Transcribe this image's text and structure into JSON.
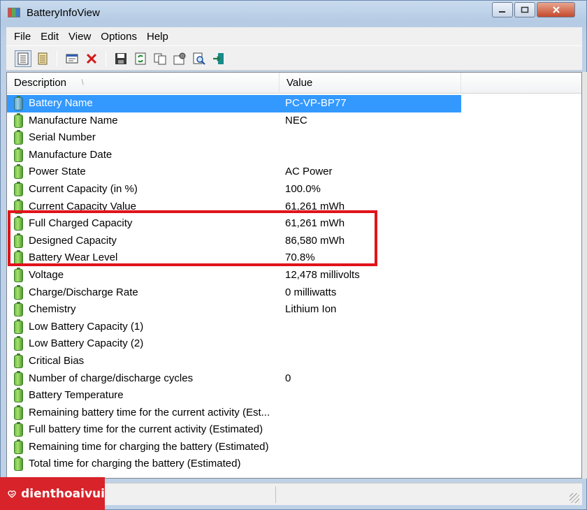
{
  "window": {
    "title": "BatteryInfoView"
  },
  "menu": [
    "File",
    "Edit",
    "View",
    "Options",
    "Help"
  ],
  "toolbar": {
    "buttons": [
      "view-list-icon",
      "view-html-icon",
      "properties-icon",
      "delete-icon",
      "save-icon",
      "refresh-icon",
      "copy-icon",
      "advanced-options-icon",
      "find-icon",
      "exit-icon"
    ]
  },
  "columns": {
    "description": "Description",
    "value": "Value"
  },
  "rows": [
    {
      "label": "Battery Name",
      "value": "PC-VP-BP77"
    },
    {
      "label": "Manufacture Name",
      "value": "NEC"
    },
    {
      "label": "Serial Number",
      "value": ""
    },
    {
      "label": "Manufacture Date",
      "value": ""
    },
    {
      "label": "Power State",
      "value": "AC Power"
    },
    {
      "label": "Current Capacity (in %)",
      "value": "100.0%"
    },
    {
      "label": "Current Capacity Value",
      "value": "61,261 mWh"
    },
    {
      "label": "Full Charged Capacity",
      "value": "61,261 mWh"
    },
    {
      "label": "Designed Capacity",
      "value": "86,580 mWh"
    },
    {
      "label": "Battery Wear Level",
      "value": "70.8%"
    },
    {
      "label": "Voltage",
      "value": "12,478 millivolts"
    },
    {
      "label": "Charge/Discharge Rate",
      "value": "0 milliwatts"
    },
    {
      "label": "Chemistry",
      "value": "Lithium Ion"
    },
    {
      "label": "Low Battery Capacity (1)",
      "value": ""
    },
    {
      "label": "Low Battery Capacity (2)",
      "value": ""
    },
    {
      "label": "Critical Bias",
      "value": ""
    },
    {
      "label": "Number of charge/discharge cycles",
      "value": "0"
    },
    {
      "label": "Battery Temperature",
      "value": ""
    },
    {
      "label": "Remaining battery time for the current activity (Est...",
      "value": ""
    },
    {
      "label": "Full battery time for the current activity (Estimated)",
      "value": ""
    },
    {
      "label": "Remaining time for charging the battery (Estimated)",
      "value": ""
    },
    {
      "label": "Total  time for charging the battery (Estimated)",
      "value": ""
    }
  ],
  "selected_row": 0,
  "status": {
    "text": "d"
  },
  "watermark": {
    "text": "dienthoaivui"
  },
  "colors": {
    "selection": "#3399ff",
    "highlight_box": "#e0131b",
    "watermark_bg": "#d8232a"
  }
}
